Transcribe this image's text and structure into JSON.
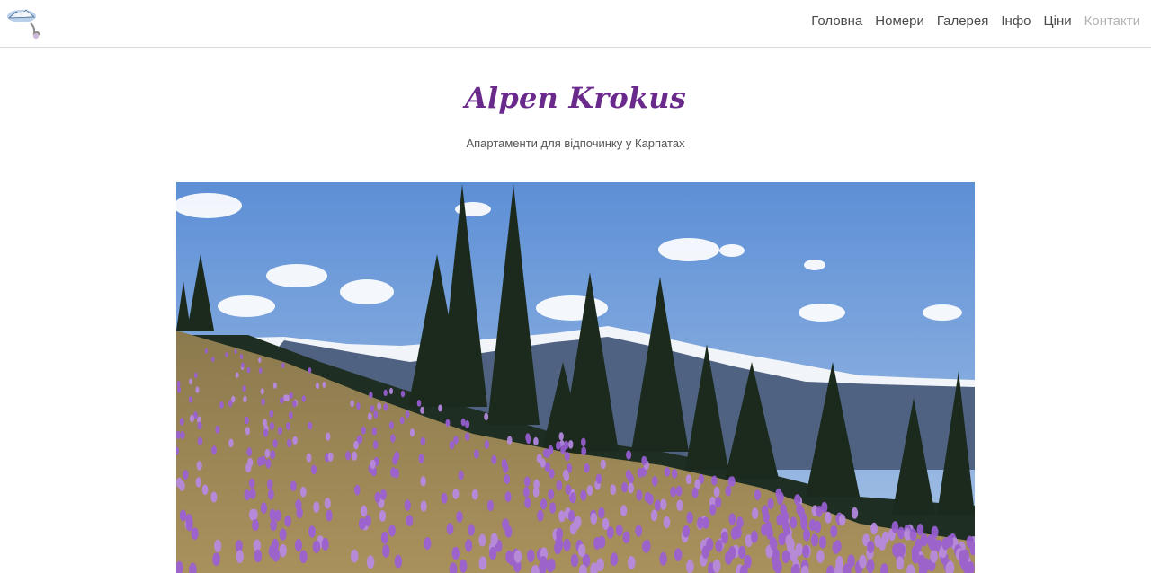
{
  "header": {
    "logo_name": "alpen-krokus-logo",
    "nav": [
      {
        "label": "Головна"
      },
      {
        "label": "Номери"
      },
      {
        "label": "Галерея"
      },
      {
        "label": "Інфо"
      },
      {
        "label": "Ціни"
      },
      {
        "label": "Контакти"
      }
    ]
  },
  "hero": {
    "title": "Alpen Krokus",
    "subtitle": "Апартаменти для відпочинку у Карпатах"
  },
  "colors": {
    "title": "#6a2a8c",
    "nav_text": "#4a4a4a",
    "nav_dim": "#b3b3b3",
    "crocus": "#9b59d6"
  }
}
